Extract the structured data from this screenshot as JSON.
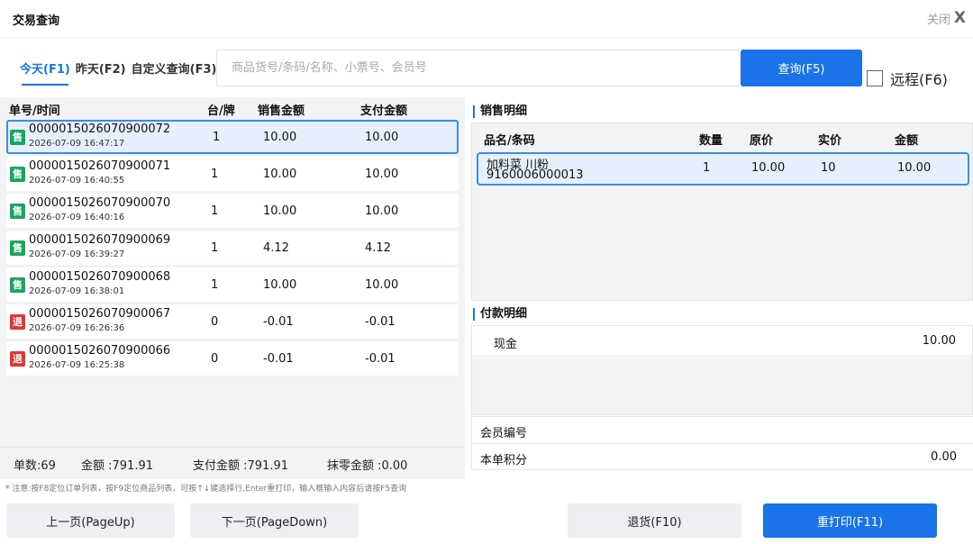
{
  "window": {
    "title": "交易查询",
    "close_label": "关闭",
    "close_glyph": "X"
  },
  "tabs": [
    {
      "label": "今天(F1)",
      "active": true
    },
    {
      "label": "昨天(F2)",
      "active": false
    },
    {
      "label": "自定义查询(F3)",
      "active": false
    }
  ],
  "search": {
    "placeholder": "商品货号/条码/名称、小票号、会员号",
    "value": ""
  },
  "query_button": "查询(F5)",
  "remote": {
    "label": "远程(F6)",
    "checked": false
  },
  "list": {
    "headers": {
      "order_time": "单号/时间",
      "table": "台/牌",
      "sale_amount": "销售金额",
      "pay_amount": "支付金额"
    },
    "rows": [
      {
        "badge": "售",
        "type": "sale",
        "no": "0000015026070900072",
        "time": "2026-07-09 16:47:17",
        "table": "1",
        "sale": "10.00",
        "pay": "10.00",
        "selected": true
      },
      {
        "badge": "售",
        "type": "sale",
        "no": "0000015026070900071",
        "time": "2026-07-09 16:40:55",
        "table": "1",
        "sale": "10.00",
        "pay": "10.00",
        "selected": false
      },
      {
        "badge": "售",
        "type": "sale",
        "no": "0000015026070900070",
        "time": "2026-07-09 16:40:16",
        "table": "1",
        "sale": "10.00",
        "pay": "10.00",
        "selected": false
      },
      {
        "badge": "售",
        "type": "sale",
        "no": "0000015026070900069",
        "time": "2026-07-09 16:39:27",
        "table": "1",
        "sale": "4.12",
        "pay": "4.12",
        "selected": false
      },
      {
        "badge": "售",
        "type": "sale",
        "no": "0000015026070900068",
        "time": "2026-07-09 16:38:01",
        "table": "1",
        "sale": "10.00",
        "pay": "10.00",
        "selected": false
      },
      {
        "badge": "退",
        "type": "refund",
        "no": "0000015026070900067",
        "time": "2026-07-09 16:26:36",
        "table": "0",
        "sale": "-0.01",
        "pay": "-0.01",
        "selected": false
      },
      {
        "badge": "退",
        "type": "refund",
        "no": "0000015026070900066",
        "time": "2026-07-09 16:25:38",
        "table": "0",
        "sale": "-0.01",
        "pay": "-0.01",
        "selected": false
      }
    ]
  },
  "summary": {
    "count": "单数:69",
    "amount": "金额 :791.91",
    "paid": "支付金额 :791.91",
    "rounding": "抹零金额 :0.00"
  },
  "note": {
    "star": "*",
    "text": " 注意:按F8定位订单列表，按F9定位商品列表，可按↑↓键选择行,Enter重打印，输入框输入内容后请按F5查询"
  },
  "sales_detail": {
    "title": "销售明细",
    "headers": {
      "name": "品名/条码",
      "qty": "数量",
      "orig": "原价",
      "actual": "实价",
      "amount": "金额"
    },
    "rows": [
      {
        "name": "加料菜 川粉",
        "code": "9160006000013",
        "qty": "1",
        "orig": "10.00",
        "actual": "10",
        "amount": "10.00"
      }
    ]
  },
  "payment_detail": {
    "title": "付款明细",
    "rows": [
      {
        "method": "现金",
        "amount": "10.00"
      }
    ]
  },
  "member": {
    "label": "会员编号",
    "value": ""
  },
  "points": {
    "label": "本单积分",
    "value": "0.00"
  },
  "buttons": {
    "prev": "上一页(PageUp)",
    "next": "下一页(PageDown)",
    "refund": "退货(F10)",
    "reprint": "重打印(F11)"
  },
  "colors": {
    "accent": "#1a73e8",
    "sale_badge": "#19a65e",
    "refund_badge": "#e03535",
    "panel_bg": "#f2f3f5"
  }
}
